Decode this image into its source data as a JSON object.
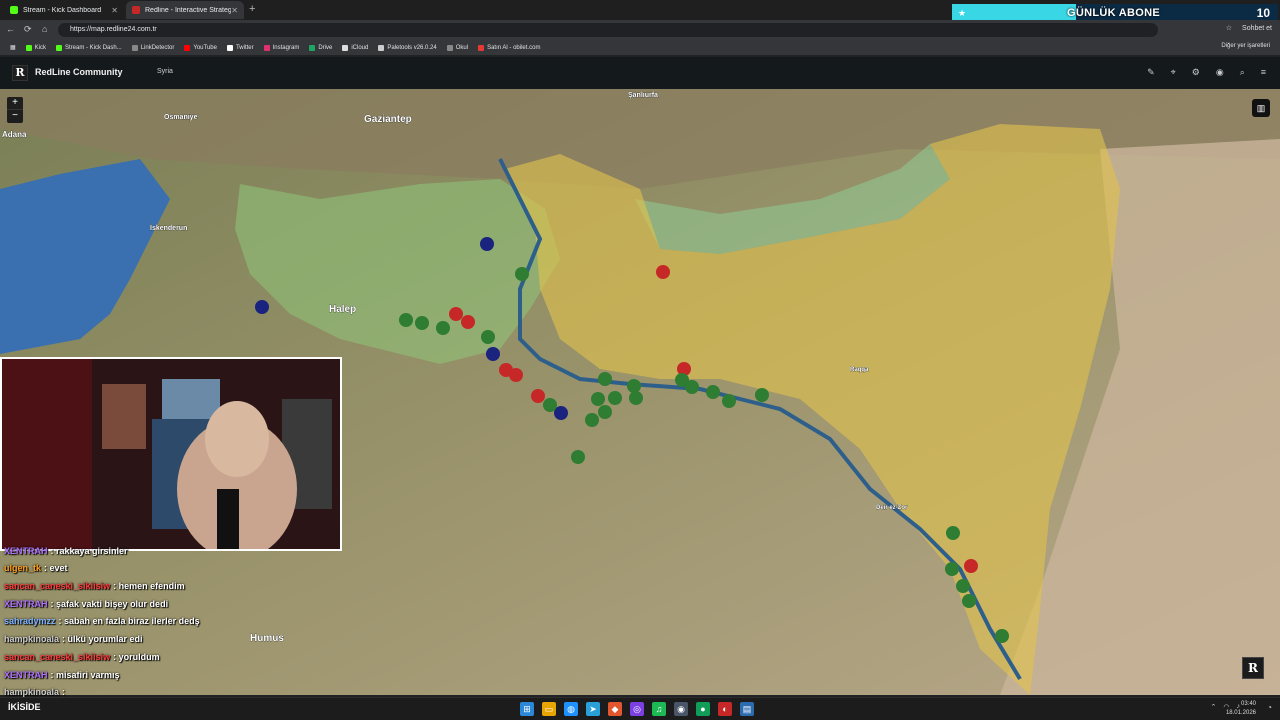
{
  "browser": {
    "tabs": [
      {
        "label": "Stream - Kick Dashboard",
        "color": "#53fc18"
      },
      {
        "label": "Redline - Interactive Strategic Map",
        "color": "#c62828"
      }
    ],
    "url": "https://map.redline24.com.tr",
    "bookmarks": [
      {
        "label": "Kick",
        "color": "#53fc18"
      },
      {
        "label": "Stream - Kick Dash...",
        "color": "#53fc18"
      },
      {
        "label": "LinkDetector",
        "color": "#888888"
      },
      {
        "label": "YouTube",
        "color": "#ff0000"
      },
      {
        "label": "Twitter",
        "color": "#ffffff"
      },
      {
        "label": "Instagram",
        "color": "#e1306c"
      },
      {
        "label": "Drive",
        "color": "#1fa463"
      },
      {
        "label": "iCloud",
        "color": "#dddddd"
      },
      {
        "label": "Paletools v26.0.24",
        "color": "#cccccc"
      },
      {
        "label": "Okul",
        "color": "#888888"
      },
      {
        "label": "Satın Al - obilet.com",
        "color": "#e53935"
      }
    ],
    "other_bookmarks": "Diğer yer işaretleri",
    "profile_label": "Sohbet et"
  },
  "overlay": {
    "banner_text": "GÜNLÜK ABONE",
    "banner_count": "10"
  },
  "app": {
    "logo": "R",
    "title": "RedLine Community",
    "region": "Syria",
    "icons": [
      "pen-icon",
      "pin-icon",
      "settings-icon",
      "camera-icon",
      "search-icon",
      "menu-icon"
    ]
  },
  "map": {
    "zoom_in": "+",
    "zoom_out": "−",
    "badge": "R",
    "places": [
      {
        "name": "Gaziantep"
      },
      {
        "name": "Halep"
      },
      {
        "name": "Humus"
      },
      {
        "name": "Adana"
      },
      {
        "name": "Osmaniye"
      },
      {
        "name": "İskenderun"
      },
      {
        "name": "Şanlıurfa"
      },
      {
        "name": "Raqqa"
      },
      {
        "name": "Deir ez-Zor"
      }
    ]
  },
  "chat": [
    {
      "user": "XENTRAH",
      "color": "#b070ff",
      "text": "rakkaya girsinler"
    },
    {
      "user": "ulgen_tk",
      "color": "#ff9f1c",
      "text": "evet"
    },
    {
      "user": "sancan_caneski_sikiisiw",
      "color": "#ff3b3b",
      "text": "hemen efendim"
    },
    {
      "user": "XENTRAH",
      "color": "#b070ff",
      "text": "şafak vakti bişey olur dedi"
    },
    {
      "user": "sahradymzz",
      "color": "#7fb3ff",
      "text": "sabah en fazla biraz ilerler dedş"
    },
    {
      "user": "hampkinoala",
      "color": "#cccccc",
      "text": "ülkü yorumlar edi"
    },
    {
      "user": "sancan_caneski_sikiisiw",
      "color": "#ff3b3b",
      "text": "yoruldum"
    },
    {
      "user": "XENTRAH",
      "color": "#b070ff",
      "text": "misafiri varmış"
    },
    {
      "user": "hampkinoala",
      "color": "#cccccc",
      "text": ""
    }
  ],
  "taskbar": {
    "left_label": "İKİSİDE",
    "time": "03:40",
    "date": "18.01.2026"
  }
}
